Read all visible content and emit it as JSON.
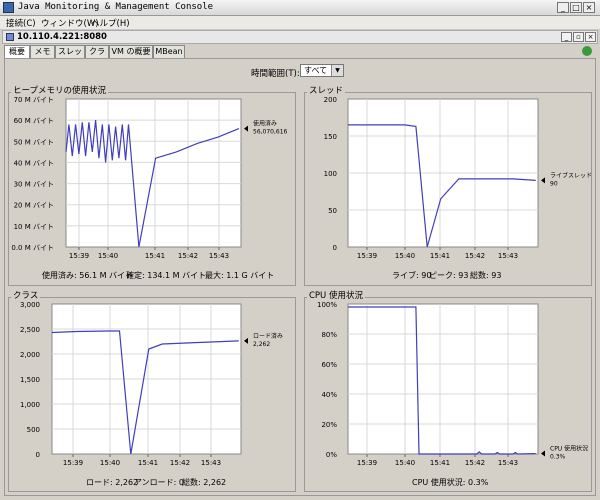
{
  "window": {
    "title": "Java Monitoring & Management Console"
  },
  "menu": [
    "接続(C)",
    "ウィンドウ(W)",
    "ヘルプ(H)"
  ],
  "connection": {
    "title": "10.110.4.221:8080"
  },
  "tabs": [
    "概要",
    "メモリ",
    "スレッド",
    "クラス",
    "VM の概要",
    "MBean"
  ],
  "time_range": {
    "label": "時間範囲(T):",
    "value": "すべて"
  },
  "panels": {
    "heap": {
      "title": "ヒープメモリの使用状況",
      "series_label_1": "使用済み",
      "series_label_2": "56,070,616",
      "stats": {
        "used": "使用済み: 56.1 M バイト",
        "committed": "確定: 134.1 M バイト",
        "max": "最大: 1.1 G バイト"
      }
    },
    "threads": {
      "title": "スレッド",
      "series_label_1": "ライブスレッド",
      "series_label_2": "90",
      "stats": {
        "live": "ライブ: 90",
        "peak": "ピーク: 93",
        "total": "総数: 93"
      }
    },
    "classes": {
      "title": "クラス",
      "series_label_1": "ロード済み",
      "series_label_2": "2,262",
      "stats": {
        "loaded": "ロード: 2,262",
        "unloaded": "アンロード: 0",
        "total": "総数: 2,262"
      }
    },
    "cpu": {
      "title": "CPU 使用状況",
      "series_label_1": "CPU 使用状況",
      "series_label_2": "0.3%",
      "stats": {
        "usage": "CPU 使用状況: 0.3%"
      }
    }
  },
  "chart_data": [
    {
      "type": "line",
      "name": "heap",
      "xticks": [
        "15:39",
        "15:40",
        "15:41",
        "15:42",
        "15:43"
      ],
      "x_range": [
        15.5,
        57.5
      ],
      "yticks": [
        "0.0 M バイト",
        "10 M バイト",
        "20 M バイト",
        "30 M バイト",
        "40 M バイト",
        "50 M バイト",
        "60 M バイト",
        "70 M バイト"
      ],
      "ylim": [
        0,
        70
      ],
      "x": [
        15.5,
        16.2,
        17,
        17.8,
        18.6,
        19.4,
        20.2,
        21,
        21.8,
        22.6,
        23.4,
        24.2,
        25,
        25.8,
        26.6,
        27.4,
        28.2,
        29,
        29.8,
        30.5,
        33,
        37,
        42,
        47,
        52,
        57
      ],
      "y": [
        45,
        58,
        43,
        58,
        44,
        59,
        43,
        59,
        45,
        60,
        42,
        58,
        40,
        58,
        41,
        57,
        42,
        58,
        41,
        58,
        0,
        42,
        45,
        49,
        52,
        56
      ]
    },
    {
      "type": "line",
      "name": "threads",
      "xticks": [
        "15:39",
        "15:40",
        "15:41",
        "15:42",
        "15:43"
      ],
      "x_range": [
        15.5,
        57.5
      ],
      "yticks": [
        "0",
        "50",
        "100",
        "150",
        "200"
      ],
      "ylim": [
        0,
        200
      ],
      "x": [
        15.5,
        28,
        30.5,
        33,
        36,
        40,
        44,
        52,
        57
      ],
      "y": [
        165,
        165,
        163,
        0,
        65,
        92,
        92,
        92,
        90
      ]
    },
    {
      "type": "line",
      "name": "classes",
      "xticks": [
        "15:39",
        "15:40",
        "15:41",
        "15:42",
        "15:43"
      ],
      "x_range": [
        15.5,
        57.5
      ],
      "yticks": [
        "0",
        "500",
        "1,000",
        "1,500",
        "2,000",
        "2,500",
        "3,000"
      ],
      "ylim": [
        0,
        3000
      ],
      "x": [
        15.5,
        21,
        28,
        30.5,
        33,
        37,
        40,
        48,
        57
      ],
      "y": [
        2430,
        2450,
        2460,
        2460,
        0,
        2100,
        2200,
        2230,
        2262
      ]
    },
    {
      "type": "line",
      "name": "cpu",
      "xticks": [
        "15:39",
        "15:40",
        "15:41",
        "15:42",
        "15:43"
      ],
      "x_range": [
        15.5,
        57.5
      ],
      "yticks": [
        "0%",
        "20%",
        "40%",
        "60%",
        "80%",
        "100%"
      ],
      "ylim": [
        0,
        100
      ],
      "x": [
        15.5,
        30.5,
        31.2,
        40,
        44,
        44.5,
        45,
        48,
        48.5,
        49,
        52,
        52.5,
        53,
        57
      ],
      "y": [
        98,
        98,
        0,
        0,
        0,
        1.5,
        0,
        0,
        1,
        0,
        0,
        1,
        0,
        0.3
      ]
    }
  ]
}
